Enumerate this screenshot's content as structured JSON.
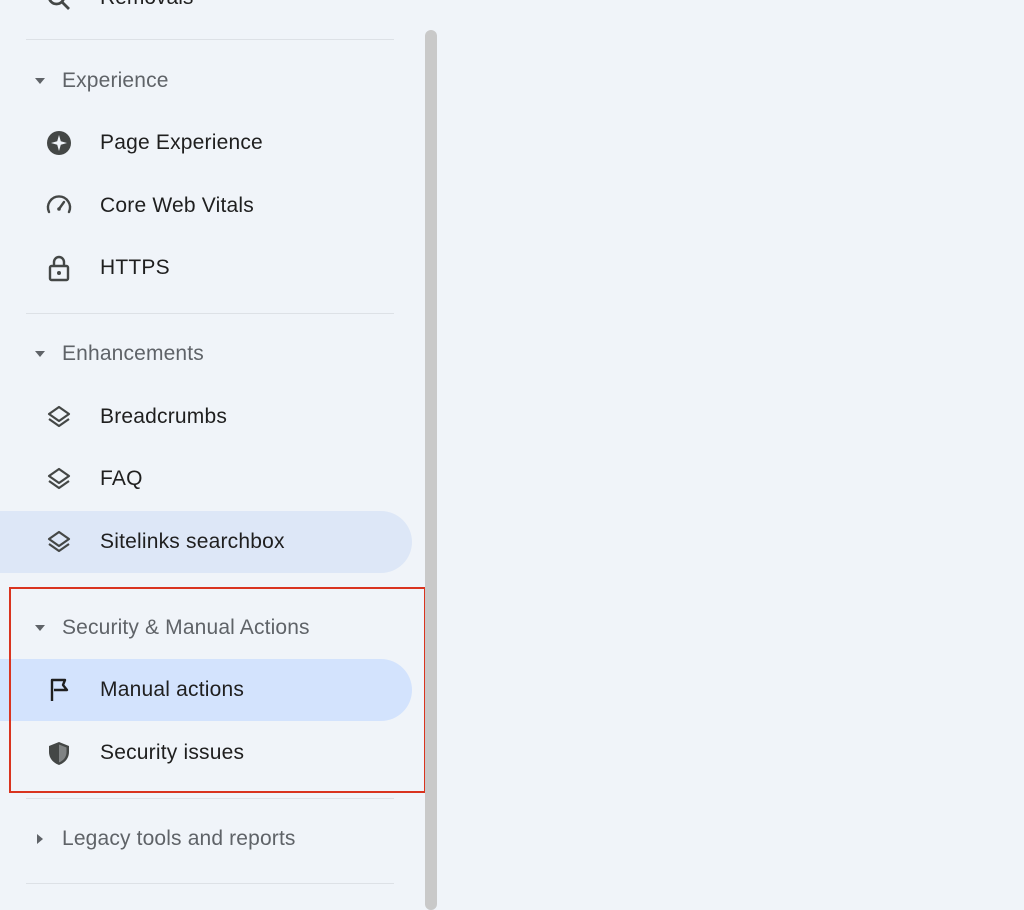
{
  "colors": {
    "background": "#f0f4f9",
    "active_item_bg": "#d3e3fd",
    "hover_item_bg": "#dde7f7",
    "highlight_border": "#d9341f",
    "icon": "#444746"
  },
  "sidebar": {
    "top_partial_item": {
      "label": "Removals",
      "icon": "search-off-icon"
    },
    "sections": [
      {
        "title": "Experience",
        "expanded": true,
        "items": [
          {
            "label": "Page Experience",
            "icon": "page-experience-icon"
          },
          {
            "label": "Core Web Vitals",
            "icon": "speedometer-icon"
          },
          {
            "label": "HTTPS",
            "icon": "lock-icon"
          }
        ]
      },
      {
        "title": "Enhancements",
        "expanded": true,
        "items": [
          {
            "label": "Breadcrumbs",
            "icon": "layers-icon"
          },
          {
            "label": "FAQ",
            "icon": "layers-icon"
          },
          {
            "label": "Sitelinks searchbox",
            "icon": "layers-icon"
          }
        ]
      },
      {
        "title": "Security & Manual Actions",
        "expanded": true,
        "items": [
          {
            "label": "Manual actions",
            "icon": "flag-icon",
            "selected": true
          },
          {
            "label": "Security issues",
            "icon": "shield-icon"
          }
        ]
      },
      {
        "title": "Legacy tools and reports",
        "expanded": false,
        "items": []
      }
    ]
  }
}
